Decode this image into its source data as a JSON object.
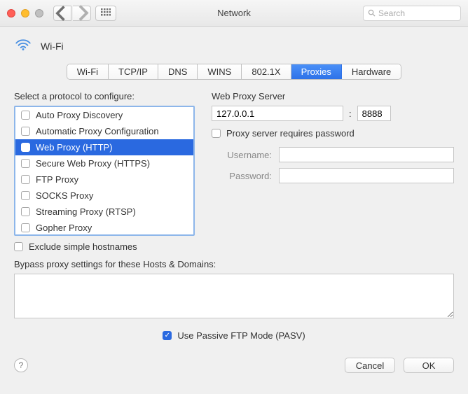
{
  "title": "Network",
  "search_placeholder": "Search",
  "service_name": "Wi-Fi",
  "tabs": [
    "Wi-Fi",
    "TCP/IP",
    "DNS",
    "WINS",
    "802.1X",
    "Proxies",
    "Hardware"
  ],
  "active_tab": 5,
  "left": {
    "label": "Select a protocol to configure:",
    "protocols": [
      "Auto Proxy Discovery",
      "Automatic Proxy Configuration",
      "Web Proxy (HTTP)",
      "Secure Web Proxy (HTTPS)",
      "FTP Proxy",
      "SOCKS Proxy",
      "Streaming Proxy (RTSP)",
      "Gopher Proxy"
    ],
    "selected": 2,
    "exclude_simple": "Exclude simple hostnames"
  },
  "right": {
    "label": "Web Proxy Server",
    "host": "127.0.0.1",
    "port": "8888",
    "requires_password": "Proxy server requires password",
    "username_label": "Username:",
    "password_label": "Password:",
    "username": "",
    "password": ""
  },
  "bypass": {
    "label": "Bypass proxy settings for these Hosts & Domains:",
    "value": ""
  },
  "pasv": "Use Passive FTP Mode (PASV)",
  "footer": {
    "cancel": "Cancel",
    "ok": "OK"
  }
}
